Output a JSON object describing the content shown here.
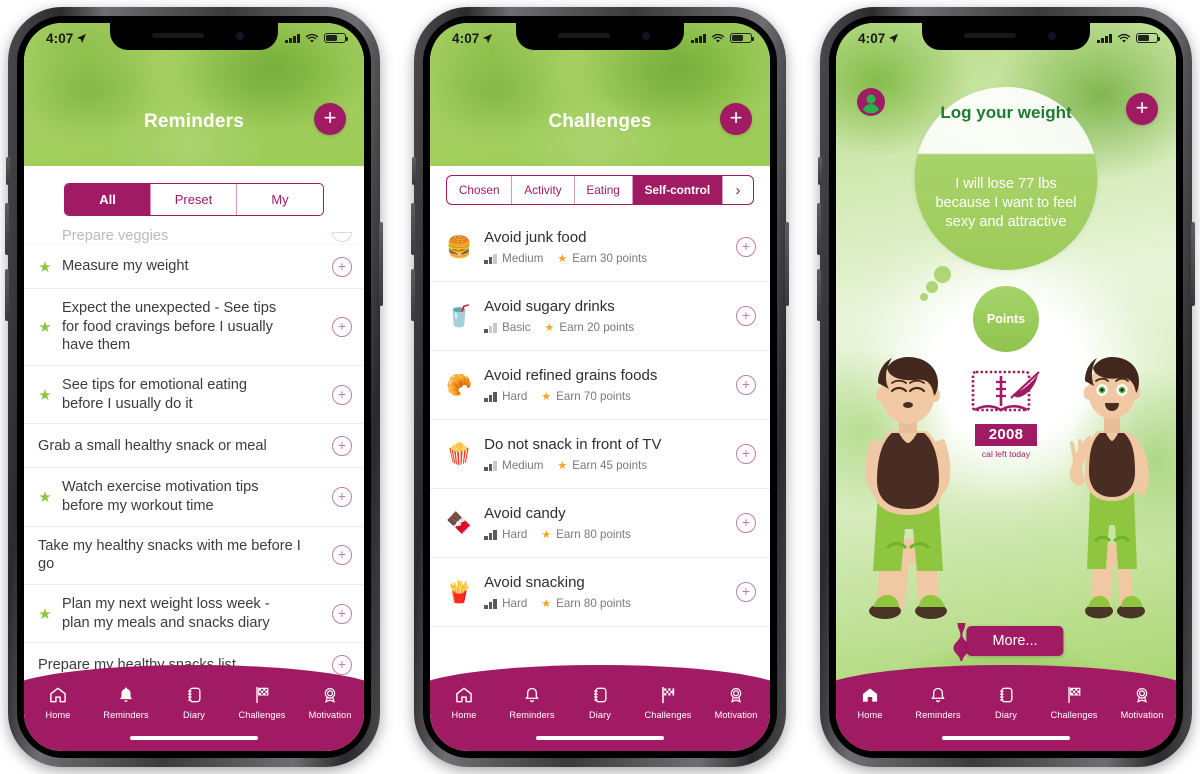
{
  "statusbar": {
    "time": "4:07",
    "location_icon": "location-arrow-icon",
    "signal_icon": "cellular-bars-icon",
    "wifi_icon": "wifi-icon",
    "battery_icon": "battery-icon"
  },
  "colors": {
    "magenta": "#a01b63",
    "green": "#a3ce5f",
    "star_green": "#8cc63e",
    "points_orange": "#f5a623",
    "dark_green_text": "#1f7a36"
  },
  "tabbar": {
    "items": [
      {
        "label": "Home",
        "icon": "home-icon"
      },
      {
        "label": "Reminders",
        "icon": "bell-icon"
      },
      {
        "label": "Diary",
        "icon": "diary-icon"
      },
      {
        "label": "Challenges",
        "icon": "checkered-flag-icon"
      },
      {
        "label": "Motivation",
        "icon": "award-ribbon-icon"
      }
    ]
  },
  "phone1": {
    "header": {
      "title": "Reminders",
      "add_button": "+",
      "add_icon": "plus-icon"
    },
    "segments": [
      {
        "label": "All",
        "active": true
      },
      {
        "label": "Preset",
        "active": false
      },
      {
        "label": "My",
        "active": false
      }
    ],
    "reminders": [
      {
        "text": "Prepare veggies",
        "starred": false,
        "clipped": true
      },
      {
        "text": "Measure my weight",
        "starred": true
      },
      {
        "text": "Expect the unexpected - See tips for food cravings before I usually have them",
        "starred": true
      },
      {
        "text": "See tips for emotional eating before I usually do it",
        "starred": true
      },
      {
        "text": "Grab a small healthy snack or meal",
        "starred": false
      },
      {
        "text": "Watch exercise motivation tips before my workout time",
        "starred": true
      },
      {
        "text": "Take my healthy snacks with me before I go",
        "starred": false
      },
      {
        "text": "Plan my next weight loss week - plan my meals and snacks diary",
        "starred": true
      },
      {
        "text": "Prepare my healthy snacks list",
        "starred": false,
        "clipped_bottom": true
      }
    ],
    "row_add_label": "+",
    "active_tab": "Reminders"
  },
  "phone2": {
    "header": {
      "title": "Challenges",
      "add_button": "+",
      "add_icon": "plus-icon"
    },
    "tabs": [
      {
        "label": "Chosen",
        "active": false
      },
      {
        "label": "Activity",
        "active": false
      },
      {
        "label": "Eating",
        "active": false
      },
      {
        "label": "Self-control",
        "active": true
      },
      {
        "label": "›",
        "active": false,
        "icon": "chevron-right-icon"
      }
    ],
    "challenges": [
      {
        "title": "Avoid junk food",
        "difficulty": "Medium",
        "points": "Earn 30 points",
        "icon": "hamburger-emoji"
      },
      {
        "title": "Avoid sugary drinks",
        "difficulty": "Basic",
        "points": "Earn 20 points",
        "icon": "soda-cup-emoji"
      },
      {
        "title": "Avoid refined grains foods",
        "difficulty": "Hard",
        "points": "Earn 70 points",
        "icon": "croissant-emoji"
      },
      {
        "title": "Do not snack in front of TV",
        "difficulty": "Medium",
        "points": "Earn 45 points",
        "icon": "popcorn-emoji"
      },
      {
        "title": "Avoid candy",
        "difficulty": "Hard",
        "points": "Earn 80 points",
        "icon": "chocolate-emoji"
      },
      {
        "title": "Avoid snacking",
        "difficulty": "Hard",
        "points": "Earn 80 points",
        "icon": "fries-emoji"
      }
    ],
    "row_add_label": "+",
    "active_tab": "Challenges"
  },
  "phone3": {
    "header": {
      "avatar_icon": "user-avatar-icon",
      "add_button": "+",
      "add_icon": "plus-icon"
    },
    "bubble": {
      "title": "Log your weight",
      "goal_text": "I will lose 77 lbs because I want to feel sexy and attractive"
    },
    "points_bubble": {
      "label": "Points"
    },
    "diary": {
      "icon": "diary-book-quill-icon",
      "calories": "2008",
      "caption": "cal left today"
    },
    "more_button": {
      "label": "More...",
      "icon": "body-shape-icon"
    },
    "characters": [
      {
        "name": "overweight-avatar"
      },
      {
        "name": "slim-avatar"
      }
    ],
    "active_tab": "Home"
  }
}
